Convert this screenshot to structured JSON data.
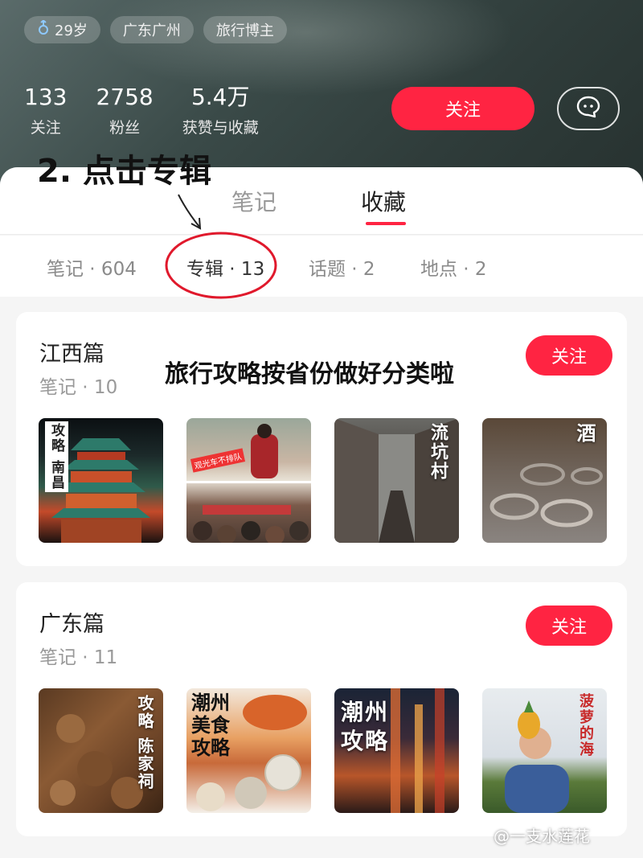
{
  "profile": {
    "tags": [
      {
        "icon": "male-icon",
        "label": "29岁"
      },
      {
        "label": "广东广州"
      },
      {
        "label": "旅行博主"
      }
    ],
    "stats": [
      {
        "value": "133",
        "label": "关注"
      },
      {
        "value": "2758",
        "label": "粉丝"
      },
      {
        "value": "5.4万",
        "label": "获赞与收藏"
      }
    ],
    "follow_label": "关注",
    "message_icon": "chat-bubble-icon"
  },
  "tabs": [
    {
      "label": "笔记",
      "active": false
    },
    {
      "label": "收藏",
      "active": true
    }
  ],
  "subtabs": [
    {
      "label": "笔记 · 604",
      "active": false
    },
    {
      "label": "专辑 · 13",
      "active": true
    },
    {
      "label": "话题 · 2",
      "active": false
    },
    {
      "label": "地点 · 2",
      "active": false
    }
  ],
  "annotations": {
    "step": "2. 点击专辑",
    "note": "旅行攻略按省份做好分类啦"
  },
  "albums": [
    {
      "title": "江西篇",
      "count": "笔记 · 10",
      "follow_label": "关注",
      "thumbs": [
        {
          "caption": "攻略 南昌"
        },
        {
          "caption": "观光车不排队"
        },
        {
          "caption": "流坑村"
        },
        {
          "caption": "酒"
        }
      ]
    },
    {
      "title": "广东篇",
      "count": "笔记 · 11",
      "follow_label": "关注",
      "thumbs": [
        {
          "caption": "攻略 陈家祠"
        },
        {
          "caption": "潮州美食攻略"
        },
        {
          "caption": "潮州攻略"
        },
        {
          "caption": "菠萝的海"
        }
      ]
    }
  ],
  "watermark": "@一支水莲花",
  "colors": {
    "accent": "#ff2442",
    "header_bg": "#3a4a48"
  }
}
